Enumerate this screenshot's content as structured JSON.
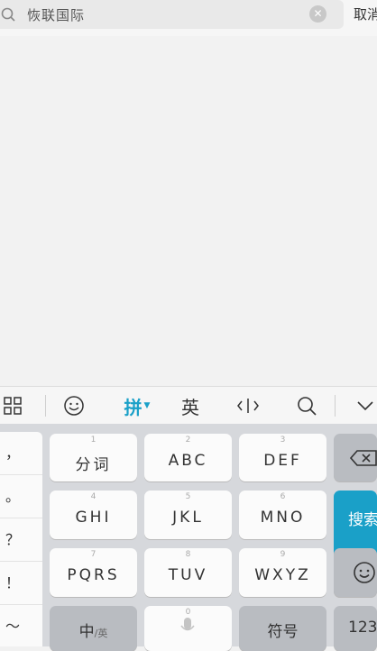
{
  "search": {
    "query": "恢联国际",
    "clear_icon": "clear-circle-icon",
    "search_icon": "magnifier-icon"
  },
  "cancel_label": "取消",
  "toolbar": {
    "pinyin_label": "拼",
    "english_label": "英",
    "icons": [
      "grid-icon",
      "emoji-icon",
      "cursor-move-icon",
      "search-icon",
      "collapse-icon"
    ]
  },
  "symbols": [
    "，",
    "。",
    "？",
    "！",
    "～"
  ],
  "keys": {
    "r1": [
      {
        "num": "1",
        "label": "分词"
      },
      {
        "num": "2",
        "label": "ABC"
      },
      {
        "num": "3",
        "label": "DEF"
      }
    ],
    "r2": [
      {
        "num": "4",
        "label": "GHI"
      },
      {
        "num": "5",
        "label": "JKL"
      },
      {
        "num": "6",
        "label": "MNO"
      }
    ],
    "r3": [
      {
        "num": "7",
        "label": "PQRS"
      },
      {
        "num": "8",
        "label": "TUV"
      },
      {
        "num": "9",
        "label": "WXYZ"
      }
    ],
    "r4": {
      "zh_label": "中",
      "zh_sub": "/英",
      "zero": "0",
      "symbols_label": "符号",
      "num_label": "123"
    }
  },
  "search_key_label": "搜索",
  "colors": {
    "accent": "#1aa0c8",
    "key_bg": "#fbfbfb",
    "dark_key_bg": "#b9bcc1"
  }
}
